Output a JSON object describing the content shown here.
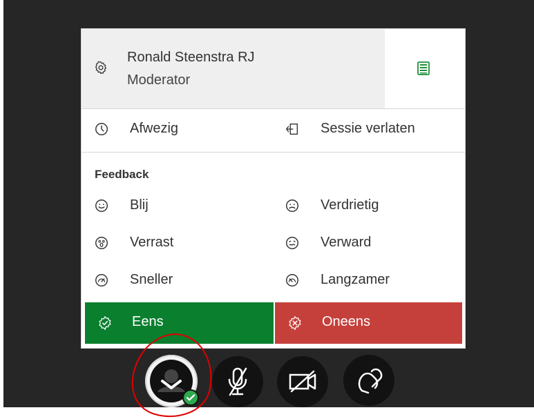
{
  "user": {
    "name": "Ronald Steenstra RJ",
    "role": "Moderator"
  },
  "status_items": {
    "away": "Afwezig",
    "leave": "Sessie verlaten"
  },
  "feedback": {
    "title": "Feedback",
    "happy": "Blij",
    "sad": "Verdrietig",
    "surprised": "Verrast",
    "confused": "Verward",
    "faster": "Sneller",
    "slower": "Langzamer",
    "agree": "Eens",
    "disagree": "Oneens"
  },
  "icons": {
    "settings": "gear-icon",
    "list": "list-icon",
    "away": "clock-icon",
    "leave": "exit-icon",
    "happy": "smile-icon",
    "sad": "frown-icon",
    "surprised": "surprised-icon",
    "confused": "confused-icon",
    "faster": "speed-fast-icon",
    "slower": "speed-slow-icon",
    "agree": "check-badge-icon",
    "disagree": "x-badge-icon",
    "microphone": "mic-off-icon",
    "camera": "camera-off-icon",
    "share": "share-icon",
    "status_badge": "check-circle-icon"
  },
  "colors": {
    "agree": "#0a7f2e",
    "disagree": "#c6403b",
    "accent_green": "#2fa84f",
    "annotation_red": "#e00000"
  }
}
